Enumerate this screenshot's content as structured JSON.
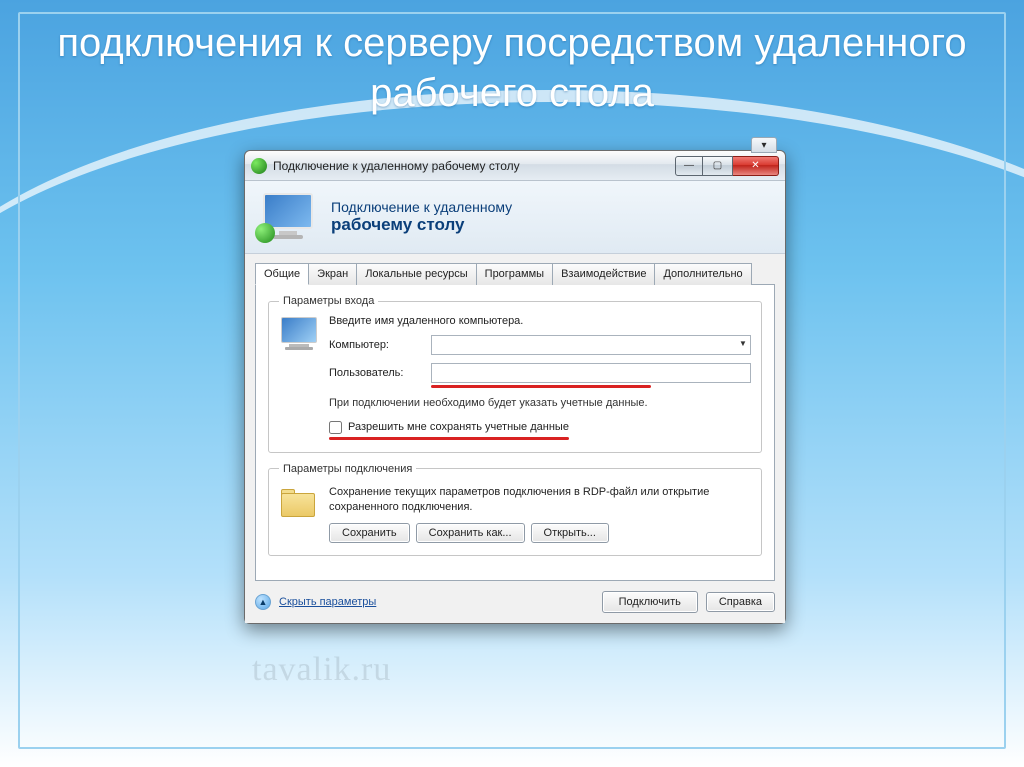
{
  "slide": {
    "title": "подключения к серверу посредством удаленного рабочего стола"
  },
  "window": {
    "title": "Подключение к удаленному рабочему столу",
    "help_glyph": "▾",
    "btn_min": "—",
    "btn_max": "▢",
    "btn_close": "✕"
  },
  "banner": {
    "line1": "Подключение к удаленному",
    "line2": "рабочему столу"
  },
  "tabs": [
    "Общие",
    "Экран",
    "Локальные ресурсы",
    "Программы",
    "Взаимодействие",
    "Дополнительно"
  ],
  "login_group": {
    "legend": "Параметры входа",
    "hint": "Введите имя удаленного компьютера.",
    "computer_label": "Компьютер:",
    "computer_value": "",
    "user_label": "Пользователь:",
    "user_value": "",
    "note": "При подключении необходимо будет указать учетные данные.",
    "save_creds": "Разрешить мне сохранять учетные данные"
  },
  "conn_group": {
    "legend": "Параметры подключения",
    "descr": "Сохранение текущих параметров подключения в RDP-файл или открытие сохраненного подключения.",
    "save": "Сохранить",
    "save_as": "Сохранить как...",
    "open": "Открыть..."
  },
  "footer": {
    "hide_params": "Скрыть параметры",
    "connect": "Подключить",
    "help": "Справка"
  },
  "watermark": "tavalik.ru"
}
